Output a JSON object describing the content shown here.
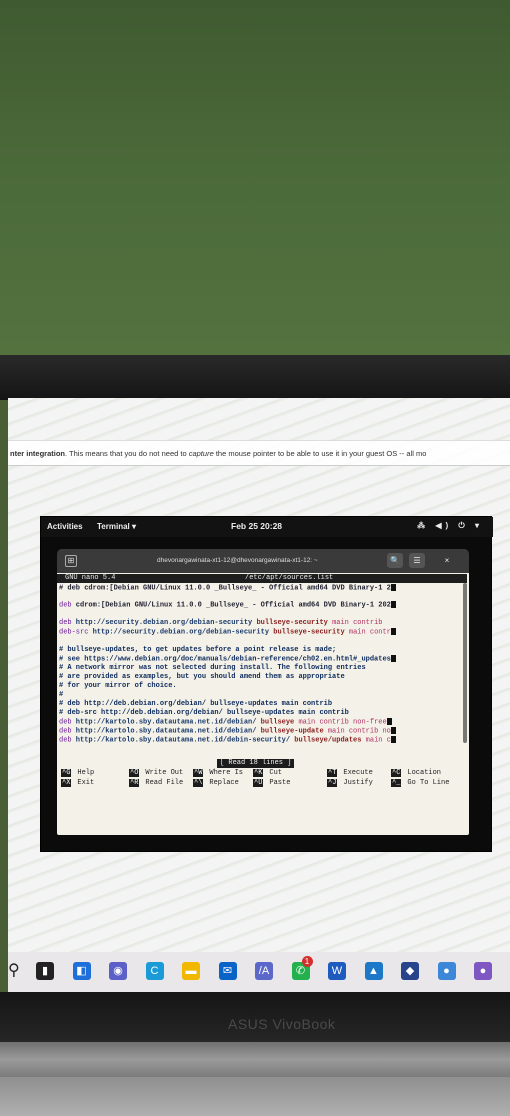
{
  "browser": {
    "page_text_bold": "nter integration",
    "page_text_1": ". This means that you do not need to ",
    "page_text_italic": "capture",
    "page_text_2": " the mouse pointer to be able to use it in your guest OS -- all mo"
  },
  "gnome": {
    "activities": "Activities",
    "app_menu": "Terminal ▾",
    "clock": "Feb 25  20:28",
    "tray": "⁂ ◀) ⏻ ▾"
  },
  "terminal": {
    "title": "dhevonargawinata-xt1-12@dhevonargawinata-xt1-12: ~",
    "search_icon": "🔍",
    "menu_icon": "☰",
    "close_icon": "×",
    "newtab_icon": "⊞"
  },
  "nano": {
    "version": "GNU nano 5.4",
    "filename": "/etc/apt/sources.list",
    "lines": [
      {
        "parts": [
          [
            "#",
            "plain"
          ],
          [
            " deb cdrom:[Debian GNU/Linux 11.0.0 _Bullseye_ - Official amd64 DVD Binary-1 2",
            "plain"
          ]
        ]
      },
      {
        "parts": [
          [
            "deb",
            "kw"
          ],
          [
            " cdrom:[Debian GNU/Linux 11.0.0 _Bullseye_ - Official amd64 DVD Binary-1 202",
            "plain"
          ]
        ]
      },
      {
        "parts": [
          [
            "deb",
            "kw"
          ],
          [
            " http://security.debian.org/debian-security ",
            "url"
          ],
          [
            "bullseye-security",
            "rel"
          ],
          [
            " main contrib",
            "cmp"
          ]
        ]
      },
      {
        "parts": [
          [
            "deb-src",
            "kw"
          ],
          [
            " http://security.debian.org/debian-security ",
            "url"
          ],
          [
            "bullseye-security",
            "rel"
          ],
          [
            " main contr",
            "cmp"
          ]
        ]
      },
      {
        "parts": [
          [
            "# bullseye-updates, to get updates before a point release is made;",
            "cmt"
          ]
        ]
      },
      {
        "parts": [
          [
            "# see https://www.debian.org/doc/manuals/debian-reference/ch02.en.html#_updates",
            "cmt"
          ]
        ]
      },
      {
        "parts": [
          [
            "# A network mirror was not selected during install.  The following entries",
            "cmt"
          ]
        ]
      },
      {
        "parts": [
          [
            "# are provided as examples, but you should amend them as appropriate",
            "cmt"
          ]
        ]
      },
      {
        "parts": [
          [
            "# for your mirror of choice.",
            "cmt"
          ]
        ]
      },
      {
        "parts": [
          [
            "#",
            "cmt"
          ]
        ]
      },
      {
        "parts": [
          [
            "# deb http://deb.debian.org/debian/ bullseye-updates main contrib",
            "cmt"
          ]
        ]
      },
      {
        "parts": [
          [
            "# deb-src http://deb.debian.org/debian/ bullseye-updates main contrib",
            "cmt"
          ]
        ]
      },
      {
        "parts": [
          [
            "deb",
            "kw"
          ],
          [
            " http://kartolo.sby.datautama.net.id/debian/ ",
            "url"
          ],
          [
            "bullseye",
            "rel"
          ],
          [
            " main contrib non-free",
            "cmp"
          ]
        ]
      },
      {
        "parts": [
          [
            "deb",
            "kw"
          ],
          [
            " http://kartolo.sby.datautama.net.id/debian/ ",
            "url"
          ],
          [
            "bullseye-update",
            "rel"
          ],
          [
            " main contrib no",
            "cmp"
          ]
        ]
      },
      {
        "parts": [
          [
            "deb",
            "kw"
          ],
          [
            " http://kartolo.sby.datautama.net.id/debin-security/ ",
            "url"
          ],
          [
            "bullseye/updates",
            "rel"
          ],
          [
            " main c",
            "cmp"
          ]
        ]
      }
    ],
    "status": "[ Read 18 lines ]",
    "shortcuts": [
      {
        "key": "^G",
        "label": "Help"
      },
      {
        "key": "^O",
        "label": "Write Out"
      },
      {
        "key": "^W",
        "label": "Where Is"
      },
      {
        "key": "^K",
        "label": "Cut"
      },
      {
        "key": "^T",
        "label": "Execute"
      },
      {
        "key": "^C",
        "label": "Location"
      },
      {
        "key": "^X",
        "label": "Exit"
      },
      {
        "key": "^R",
        "label": "Read File"
      },
      {
        "key": "^\\",
        "label": "Replace"
      },
      {
        "key": "^U",
        "label": "Paste"
      },
      {
        "key": "^J",
        "label": "Justify"
      },
      {
        "key": "^_",
        "label": "Go To Line"
      }
    ]
  },
  "taskbar": {
    "search_icon": "⚲",
    "icons": [
      {
        "name": "task-view-icon",
        "glyph": "▮",
        "color": "#222222"
      },
      {
        "name": "widgets-icon",
        "glyph": "◧",
        "color": "#1e6fd9"
      },
      {
        "name": "chat-icon",
        "glyph": "◉",
        "color": "#5b5fc7"
      },
      {
        "name": "edge-icon",
        "glyph": "C",
        "color": "#1a9bd7"
      },
      {
        "name": "file-explorer-icon",
        "glyph": "▬",
        "color": "#f2b800"
      },
      {
        "name": "mail-icon",
        "glyph": "✉",
        "color": "#0a64c8"
      },
      {
        "name": "vscode-icon",
        "glyph": "/A",
        "color": "#5b68c9"
      },
      {
        "name": "whatsapp-icon",
        "glyph": "✆",
        "color": "#23b14d"
      },
      {
        "name": "word-icon",
        "glyph": "W",
        "color": "#1f5bbf"
      },
      {
        "name": "photos-icon",
        "glyph": "▲",
        "color": "#1d78c8"
      },
      {
        "name": "virtualbox-icon",
        "glyph": "◆",
        "color": "#27448c"
      },
      {
        "name": "chrome-icon",
        "glyph": "●",
        "color": "#3d87d8"
      },
      {
        "name": "chrome-profile-icon",
        "glyph": "●",
        "color": "#7e57c2"
      }
    ],
    "badge": "1"
  },
  "laptop": {
    "brand": "ASUS VivoBook"
  }
}
